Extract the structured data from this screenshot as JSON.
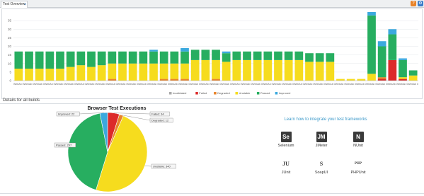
{
  "tab": {
    "title": "Test Overview",
    "close": "×"
  },
  "toolbar": {
    "help_icon": "help-icon",
    "settings_icon": "gear-icon"
  },
  "details_label": "Details for all builds",
  "colors": {
    "Invalidated": "#a9a9a9",
    "Failed": "#dc2a2a",
    "Degraded": "#e8832a",
    "Unstable": "#f6dc1e",
    "Passed": "#27ae60",
    "Improved": "#3ba9de"
  },
  "chart_data": [
    {
      "type": "bar",
      "stacked": true,
      "categories": [
        "WebAb 0",
        "WebAb 0",
        "WebAb 0",
        "WebAb 0",
        "WebAb 0",
        "WebAb 0",
        "WebAb 0",
        "WebAb 0",
        "WebAb 0",
        "WebAb 0",
        "WebAb 0",
        "WebAb 0",
        "WebAb 0",
        "WebAb 0",
        "WebAb 0",
        "WebAb 0",
        "WebAb 0",
        "WebAb 0",
        "WebAb 0",
        "WebAb 0",
        "WebAb 0",
        "WebAb 0",
        "WebAb 0",
        "WebAb 0",
        "WebAb 0",
        "WebAb 0",
        "WebAb 0",
        "WebAb 0",
        "WebAb 0",
        "WebAb 0",
        "WebAb 0",
        "WebAb 0",
        "WebAb 0",
        "WebAb 0",
        "WebAb 0",
        "WebAb 0",
        "WebAb 0",
        "WebAb 0",
        "WebAb 0"
      ],
      "series": [
        {
          "name": "Invalidated",
          "values": [
            0,
            0,
            0,
            0,
            0,
            0,
            0,
            0,
            0,
            0,
            0,
            0,
            0,
            0,
            0,
            0,
            0,
            0,
            0,
            0,
            0,
            0,
            0,
            0,
            0,
            0,
            0,
            0,
            0,
            0,
            0,
            0,
            0,
            0,
            0,
            0,
            0,
            0,
            0
          ]
        },
        {
          "name": "Failed",
          "values": [
            0,
            0,
            0,
            0,
            0,
            0,
            0,
            0,
            0,
            0,
            0,
            0,
            0,
            0,
            0,
            0,
            0,
            0,
            0,
            0,
            0,
            0,
            0,
            0,
            0,
            0,
            0,
            0,
            0,
            0,
            0,
            0,
            0,
            0,
            0,
            1,
            12,
            1,
            0
          ]
        },
        {
          "name": "Degraded",
          "values": [
            0,
            0,
            0,
            0,
            0,
            0,
            0,
            0,
            0,
            1,
            0,
            0,
            0,
            0,
            1,
            1,
            1,
            0,
            0,
            1,
            0,
            0,
            0,
            0,
            0,
            0,
            0,
            0,
            0,
            0,
            0,
            0,
            0,
            0,
            0,
            1,
            0,
            0,
            0
          ]
        },
        {
          "name": "Unstable",
          "values": [
            7,
            7,
            7,
            7,
            7,
            8,
            9,
            8,
            9,
            9,
            10,
            10,
            10,
            10,
            9,
            9,
            9,
            12,
            12,
            11,
            11,
            12,
            12,
            12,
            12,
            12,
            12,
            12,
            11,
            11,
            11,
            1,
            1,
            1,
            4,
            0,
            0,
            1,
            3
          ]
        },
        {
          "name": "Passed",
          "values": [
            10,
            10,
            10,
            10,
            10,
            9,
            8,
            9,
            8,
            7,
            7,
            7,
            7,
            7,
            7,
            7,
            7,
            6,
            6,
            6,
            5,
            5,
            5,
            5,
            5,
            5,
            5,
            5,
            5,
            5,
            5,
            0,
            0,
            0,
            34,
            18,
            15,
            10,
            3
          ]
        },
        {
          "name": "Improved",
          "values": [
            0,
            0,
            0,
            0,
            0,
            0,
            0,
            0,
            0,
            0,
            0,
            0,
            0,
            1,
            0,
            0,
            2,
            0,
            0,
            0,
            1,
            0,
            0,
            0,
            0,
            0,
            0,
            0,
            0,
            0,
            0,
            0,
            0,
            0,
            2,
            3,
            3,
            1,
            0
          ]
        }
      ],
      "ylim": [
        0,
        40
      ],
      "yticks": [
        0,
        5,
        10,
        15,
        20,
        25,
        30,
        35
      ],
      "grid": true,
      "legend_position": "bottom"
    },
    {
      "type": "pie",
      "title": "Browser Test Executions",
      "slices": [
        {
          "label": "Failed: 34",
          "name": "Failed",
          "value": 34
        },
        {
          "label": "Degraded: 12",
          "name": "Degraded",
          "value": 12
        },
        {
          "label": "Unstable: 340",
          "name": "Unstable",
          "value": 340
        },
        {
          "label": "Passed: 297",
          "name": "Passed",
          "value": 297
        },
        {
          "label": "Improved: 22",
          "name": "Improved",
          "value": 22
        }
      ]
    }
  ],
  "integrate": {
    "link": "Learn how to integrate your test frameworks",
    "frameworks": [
      {
        "name": "Selenium",
        "icon": "selenium-icon",
        "glyph": "Se"
      },
      {
        "name": "JMeter",
        "icon": "jmeter-icon",
        "glyph": "JM"
      },
      {
        "name": "NUnit",
        "icon": "nunit-icon",
        "glyph": "N"
      },
      {
        "name": "JUnit",
        "icon": "junit-icon",
        "glyph": "JU"
      },
      {
        "name": "SoapUI",
        "icon": "soapui-icon",
        "glyph": "S"
      },
      {
        "name": "PHPUnit",
        "icon": "phpunit-icon",
        "glyph": "PHP"
      }
    ]
  }
}
